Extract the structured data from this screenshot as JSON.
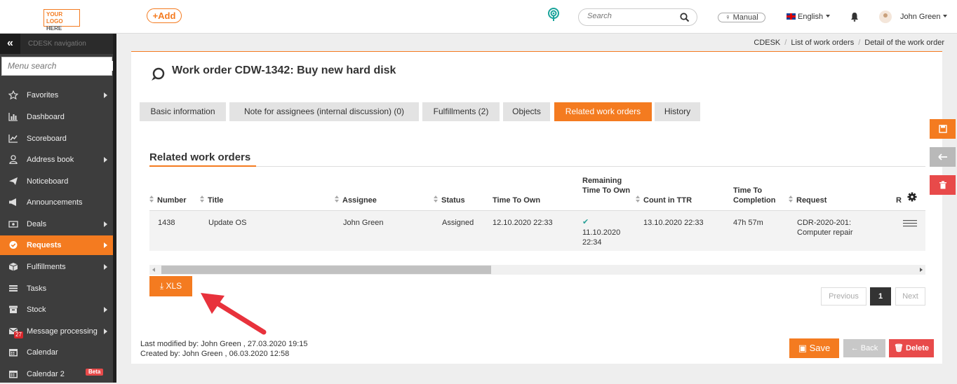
{
  "header": {
    "logo_line1": "YOUR LOGO",
    "logo_line2": "HERE",
    "add_label": "+Add",
    "search_placeholder": "Search",
    "manual_label": "Manual",
    "language": "English",
    "user_name": "John Green"
  },
  "sidebar": {
    "nav_title": "CDESK navigation",
    "collapse_glyph": "«",
    "menu_search_placeholder": "Menu search",
    "items": [
      {
        "label": "Favorites",
        "icon": "star-icon"
      },
      {
        "label": "Dashboard",
        "icon": "bar-chart-icon"
      },
      {
        "label": "Scoreboard",
        "icon": "line-chart-icon"
      },
      {
        "label": "Address book",
        "icon": "user-icon"
      },
      {
        "label": "Noticeboard",
        "icon": "paper-plane-icon"
      },
      {
        "label": "Announcements",
        "icon": "megaphone-icon"
      },
      {
        "label": "Deals",
        "icon": "money-icon"
      },
      {
        "label": "Requests",
        "icon": "check-circle-icon"
      },
      {
        "label": "Fulfillments",
        "icon": "box-icon"
      },
      {
        "label": "Tasks",
        "icon": "list-icon"
      },
      {
        "label": "Stock",
        "icon": "archive-icon"
      },
      {
        "label": "Message processing",
        "icon": "envelope-icon",
        "badge": "27"
      },
      {
        "label": "Calendar",
        "icon": "calendar-icon"
      },
      {
        "label": "Calendar 2",
        "icon": "calendar-icon",
        "badge": "Beta"
      }
    ]
  },
  "breadcrumb": [
    "CDESK",
    "List of work orders",
    "Detail of the work order"
  ],
  "page": {
    "title": "Work order CDW-1342: Buy new hard disk",
    "tabs": [
      "Basic information",
      "Note for assignees (internal discussion) (0)",
      "Fulfillments (2)",
      "Objects",
      "Related work orders",
      "History"
    ],
    "active_tab": "Related work orders",
    "section_title": "Related work orders"
  },
  "table": {
    "columns": [
      "Number",
      "Title",
      "Assignee",
      "Status",
      "Time To Own",
      "Remaining Time To Own",
      "Count in TTR",
      "Time To Completion",
      "Request",
      "R"
    ],
    "rows": [
      {
        "number": "1438",
        "title": "Update OS",
        "assignee": "John Green",
        "status": "Assigned",
        "time_to_own": "12.10.2020 22:33",
        "remaining_time_to_own": "11.10.2020 22:34",
        "count_in_ttr": "13.10.2020 22:33",
        "time_to_completion": "47h 57m",
        "request": "CDR-2020-201: Computer repair"
      }
    ]
  },
  "export": {
    "xls_label": "XLS"
  },
  "pagination": {
    "previous": "Previous",
    "current": "1",
    "next": "Next"
  },
  "meta": {
    "last_modified": "Last modified by:  John Green , 27.03.2020 19:15",
    "created": "Created by:  John Green , 06.03.2020 12:58"
  },
  "actions": {
    "save": "Save",
    "back": "Back",
    "delete": "Delete"
  },
  "colors": {
    "accent": "#f47b20",
    "danger": "#e84a4a",
    "sidebar": "#3d3d3d",
    "annotation_arrow": "#e8323c"
  }
}
